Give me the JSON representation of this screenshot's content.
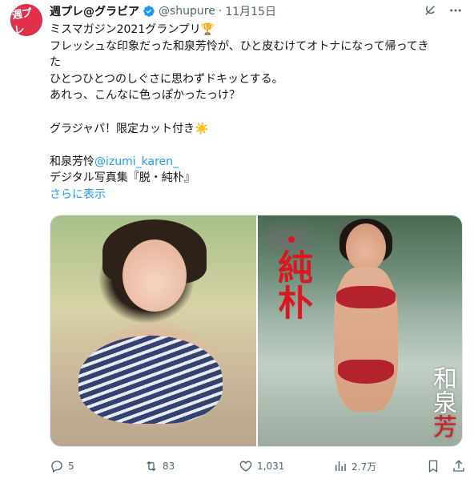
{
  "tweet": {
    "display_name": "週プレ@グラビア",
    "handle": "@shupure",
    "separator": "·",
    "date": "11月15日",
    "avatar_label": "週プレ",
    "lines": [
      "ミスマガジン2021グランプリ🏆",
      "フレッシュな印象だった和泉芳怜が、ひと皮むけてオトナになって帰ってき",
      "た",
      "ひとつひとつのしぐさに思わずドキッとする。",
      "あれっ、こんなに色っぽかったっけ？",
      "",
      "グラジャパ！限定カット付き☀️",
      ""
    ],
    "author_prefix": "和泉芳怜",
    "mention": "@izumi_karen_",
    "book_line": "デジタル写真集『脱・純朴』",
    "show_more": "さらに表示"
  },
  "media": {
    "right_title": "純朴",
    "right_name_top": "和泉",
    "right_name_bottom": "芳"
  },
  "actions": {
    "replies": "5",
    "retweets": "83",
    "likes": "1,031",
    "views": "2.7万"
  },
  "colors": {
    "link": "#1d9bf0",
    "verified": "#1d9bf0",
    "text_secondary": "#536471"
  },
  "icons": [
    "verified-badge-icon",
    "grok-icon",
    "more-icon",
    "reply-icon",
    "retweet-icon",
    "like-icon",
    "views-icon",
    "bookmark-icon",
    "share-icon"
  ]
}
